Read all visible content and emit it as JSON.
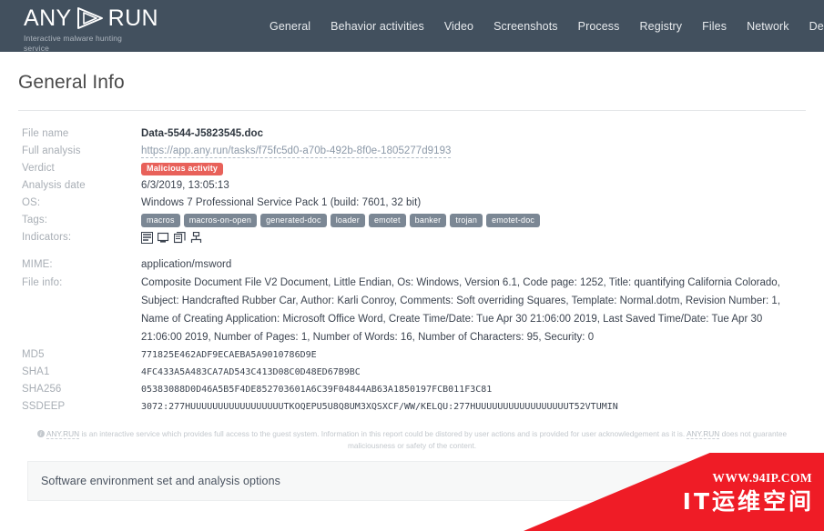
{
  "header": {
    "logo": {
      "text_left": "ANY",
      "text_right": "RUN",
      "mark": "play-triangle-icon",
      "tagline": "Interactive malware hunting service"
    },
    "nav": [
      {
        "label": "General"
      },
      {
        "label": "Behavior activities"
      },
      {
        "label": "Video"
      },
      {
        "label": "Screenshots"
      },
      {
        "label": "Process"
      },
      {
        "label": "Registry"
      },
      {
        "label": "Files"
      },
      {
        "label": "Network"
      },
      {
        "label": "Debug"
      }
    ]
  },
  "page": {
    "title": "General Info"
  },
  "general_info": {
    "file_name": {
      "label": "File name",
      "value": "Data-5544-J5823545.doc"
    },
    "full_analysis": {
      "label": "Full analysis",
      "value": "https://app.any.run/tasks/f75fc5d0-a70b-492b-8f0e-1805277d9193"
    },
    "verdict": {
      "label": "Verdict",
      "value": "Malicious activity"
    },
    "analysis_date": {
      "label": "Analysis date",
      "value": "6/3/2019, 13:05:13"
    },
    "os": {
      "label": "OS:",
      "value": "Windows 7 Professional Service Pack 1 (build: 7601, 32 bit)"
    },
    "tags": {
      "label": "Tags:",
      "values": [
        "macros",
        "macros-on-open",
        "generated-doc",
        "loader",
        "emotet",
        "banker",
        "trojan",
        "emotet-doc"
      ]
    },
    "indicators": {
      "label": "Indicators:",
      "icons": [
        "network-indicator-icon",
        "monitor-indicator-icon",
        "files-indicator-icon",
        "process-indicator-icon"
      ]
    },
    "mime": {
      "label": "MIME:",
      "value": "application/msword"
    },
    "file_info": {
      "label": "File info:",
      "value": "Composite Document File V2 Document, Little Endian, Os: Windows, Version 6.1, Code page: 1252, Title: quantifying California Colorado, Subject: Handcrafted Rubber Car, Author: Karli Conroy, Comments: Soft overriding Squares, Template: Normal.dotm, Revision Number: 1, Name of Creating Application: Microsoft Office Word, Create Time/Date: Tue Apr 30 21:06:00 2019, Last Saved Time/Date: Tue Apr 30 21:06:00 2019, Number of Pages: 1, Number of Words: 16, Number of Characters: 95, Security: 0"
    },
    "md5": {
      "label": "MD5",
      "value": "771825E462ADF9ECAEBA5A9010786D9E"
    },
    "sha1": {
      "label": "SHA1",
      "value": "4FC433A5A483CA7AD543C413D08C0D48ED67B9BC"
    },
    "sha256": {
      "label": "SHA256",
      "value": "05383088D0D46A5B5F4DE852703601A6C39F04844AB63A1850197FCB011F3C81"
    },
    "ssdeep": {
      "label": "SSDEEP",
      "value": "3072:277HUUUUUUUUUUUUUUUUUTKOQEPU5U8Q8UM3XQSXCF/WW/KELQU:277HUUUUUUUUUUUUUUUUUT52VTUMIN"
    }
  },
  "disclaimer": {
    "brand_1": "ANY.RUN",
    "text_1": "is an interactive service which provides full access to the guest system. Information in this report could be distored by user actions and is provided for user acknowledgement as it is.",
    "brand_2": "ANY.RUN",
    "text_2": "does not guarantee maliciousness or safety of the content."
  },
  "bottom_panel": {
    "label": "Software environment set and analysis options"
  },
  "watermark": {
    "url": "WWW.94IP.COM",
    "title": "IT运维空间"
  },
  "colors": {
    "header_bg": "#42505e",
    "verdict_badge": "#e8615a",
    "tag_bg": "#7b8794",
    "watermark_red": "#ef1c26",
    "label_text": "#a8aeb5",
    "value_text": "#3c4450"
  }
}
